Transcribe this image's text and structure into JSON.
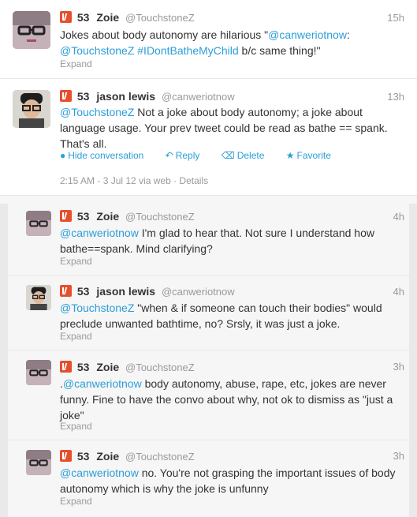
{
  "tweets": [
    {
      "score": "53",
      "name": "Zoie",
      "handle": "@TouchstoneZ",
      "time": "15h",
      "text_pre": "Jokes about body autonomy are hilarious \"",
      "mention": "@canweriotnow",
      "text_mid": ":",
      "mention2": "@TouchstoneZ",
      "hashtag": "#IDontBatheMyChild",
      "text_post": " b/c same thing!\"",
      "expand": "Expand"
    },
    {
      "score": "53",
      "name": "jason lewis",
      "handle": "@canweriotnow",
      "time": "13h",
      "mention": "@TouchstoneZ",
      "text": " Not a joke about body autonomy; a joke about language usage. Your prev tweet could be read as bathe == spank. That's all.",
      "actions": {
        "hide": "Hide conversation",
        "reply": "Reply",
        "delete": "Delete",
        "favorite": "Favorite"
      },
      "meta": "2:15 AM - 3 Jul 12 via web · Details"
    },
    {
      "score": "53",
      "name": "Zoie",
      "handle": "@TouchstoneZ",
      "time": "4h",
      "mention": "@canweriotnow",
      "text": " I'm glad to hear that. Not sure I understand how bathe==spank. Mind clarifying?",
      "expand": "Expand"
    },
    {
      "score": "53",
      "name": "jason lewis",
      "handle": "@canweriotnow",
      "time": "4h",
      "mention": "@TouchstoneZ",
      "text": " \"when & if someone can touch their bodies\" would preclude unwanted bathtime, no? Srsly, it was just a joke.",
      "expand": "Expand"
    },
    {
      "score": "53",
      "name": "Zoie",
      "handle": "@TouchstoneZ",
      "time": "3h",
      "prefix": ".",
      "mention": "@canweriotnow",
      "text": " body autonomy, abuse, rape, etc, jokes are never funny. Fine to have the convo about why, not ok to dismiss as \"just a joke\"",
      "expand": "Expand"
    },
    {
      "score": "53",
      "name": "Zoie",
      "handle": "@TouchstoneZ",
      "time": "3h",
      "mention": "@canweriotnow",
      "text": " no. You're not grasping the important issues of body autonomy which is why the joke is unfunny",
      "expand": "Expand"
    }
  ],
  "colors": {
    "link": "#2b9ed8",
    "klout": "#e54f2d",
    "muted": "#999999"
  },
  "icons": {
    "klout": "klout-icon",
    "hide": "conversation-icon",
    "reply": "reply-arrow-icon",
    "delete": "trash-icon",
    "favorite": "star-icon"
  }
}
